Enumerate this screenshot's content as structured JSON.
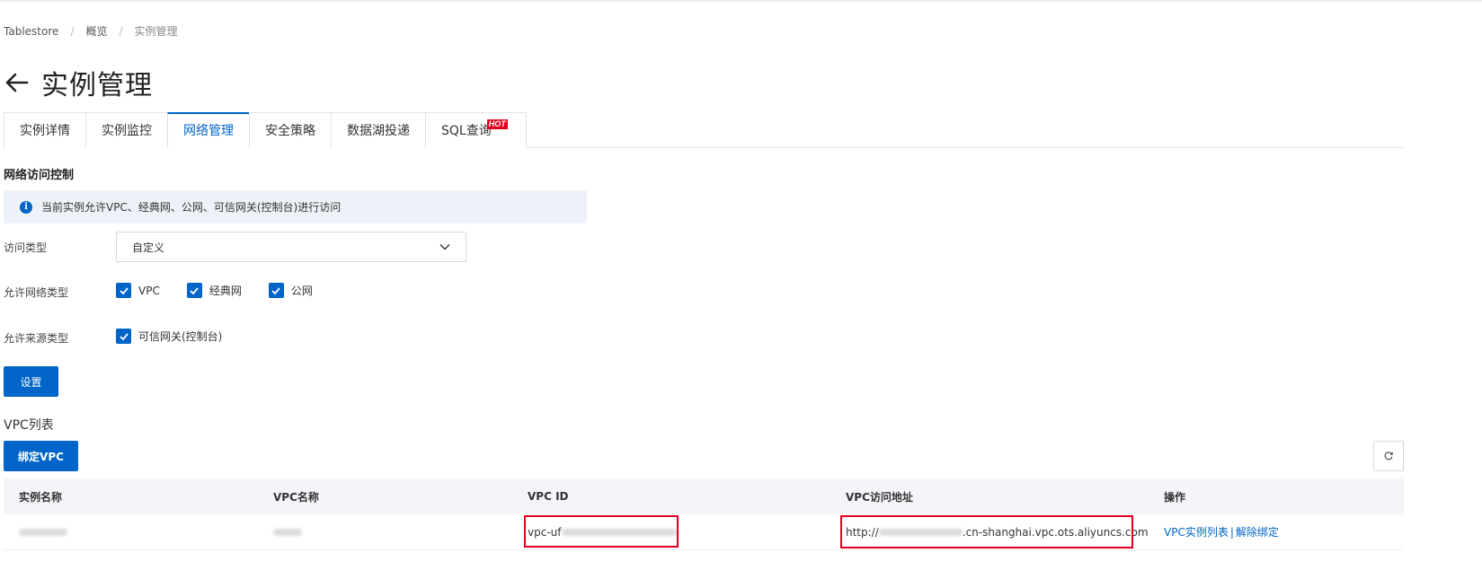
{
  "breadcrumb": [
    "Tablestore",
    "概览",
    "实例管理"
  ],
  "page_title": "实例管理",
  "tabs": [
    {
      "label": "实例详情",
      "active": false
    },
    {
      "label": "实例监控",
      "active": false
    },
    {
      "label": "网络管理",
      "active": true
    },
    {
      "label": "安全策略",
      "active": false
    },
    {
      "label": "数据湖投递",
      "active": false
    },
    {
      "label": "SQL查询",
      "active": false,
      "badge": "HOT"
    }
  ],
  "network": {
    "section_title": "网络访问控制",
    "info": "当前实例允许VPC、经典网、公网、可信网关(控制台)进行访问",
    "access_type_label": "访问类型",
    "access_type_value": "自定义",
    "network_type_label": "允许网络类型",
    "network_types": [
      "VPC",
      "经典网",
      "公网"
    ],
    "source_type_label": "允许来源类型",
    "source_types": [
      "可信网关(控制台)"
    ],
    "set_button": "设置"
  },
  "vpc": {
    "list_title": "VPC列表",
    "bind_button": "绑定VPC",
    "columns": [
      "实例名称",
      "VPC名称",
      "VPC ID",
      "VPC访问地址",
      "操作"
    ],
    "row": {
      "vpc_id_prefix": "vpc-uf",
      "address_prefix": "http://",
      "address_suffix": ".cn-shanghai.vpc.ots.aliyuncs.com",
      "action_list": "VPC实例列表",
      "action_separator": "|",
      "action_unbind": "解除绑定"
    }
  },
  "colors": {
    "primary": "#0064c8",
    "hot_badge": "#e1001e",
    "info_bg": "#edf2f8",
    "highlight_border": "#e1001e"
  }
}
